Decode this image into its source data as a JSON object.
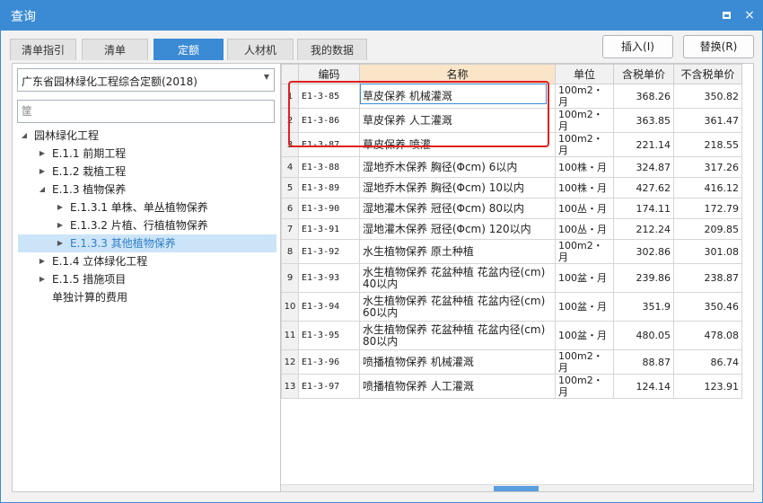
{
  "window": {
    "title": "查询",
    "maximize_icon": "maximize-icon",
    "close_icon": "close-icon",
    "close_glyph": "×"
  },
  "tabs": [
    {
      "label": "清单指引",
      "active": false
    },
    {
      "label": "清单",
      "active": false
    },
    {
      "label": "定额",
      "active": true
    },
    {
      "label": "人材机",
      "active": false
    },
    {
      "label": "我的数据",
      "active": false
    }
  ],
  "actions": {
    "insert_label": "插入(I)",
    "replace_label": "替换(R)"
  },
  "left": {
    "dropdown_value": "广东省园林绿化工程综合定额(2018)",
    "search_placeholder": "筐",
    "tree": [
      {
        "label": "园林绿化工程",
        "level": 0,
        "expanded": true
      },
      {
        "label": "E.1.1 前期工程",
        "level": 1,
        "expanded": false
      },
      {
        "label": "E.1.2 栽植工程",
        "level": 1,
        "expanded": false
      },
      {
        "label": "E.1.3 植物保养",
        "level": 1,
        "expanded": true
      },
      {
        "label": "E.1.3.1 单株、单丛植物保养",
        "level": 2,
        "expanded": false
      },
      {
        "label": "E.1.3.2 片植、行植植物保养",
        "level": 2,
        "expanded": false
      },
      {
        "label": "E.1.3.3 其他植物保养",
        "level": 2,
        "expanded": false,
        "selected": true
      },
      {
        "label": "E.1.4 立体绿化工程",
        "level": 1,
        "expanded": false
      },
      {
        "label": "E.1.5 措施项目",
        "level": 1,
        "expanded": false
      },
      {
        "label": "单独计算的费用",
        "level": 1,
        "leaf": true
      }
    ]
  },
  "grid": {
    "columns": [
      "编码",
      "名称",
      "单位",
      "含税单价",
      "不含税单价"
    ],
    "rows": [
      {
        "no": "1",
        "code": "E1-3-85",
        "name": "草皮保养 机械灌溉",
        "unit": "100m2・月",
        "price_tax": "368.26",
        "price_notax": "350.82"
      },
      {
        "no": "2",
        "code": "E1-3-86",
        "name": "草皮保养 人工灌溉",
        "unit": "100m2・月",
        "price_tax": "363.85",
        "price_notax": "361.47"
      },
      {
        "no": "3",
        "code": "E1-3-87",
        "name": "草皮保养 喷灌",
        "unit": "100m2・月",
        "price_tax": "221.14",
        "price_notax": "218.55"
      },
      {
        "no": "4",
        "code": "E1-3-88",
        "name": "湿地乔木保养 胸径(Φcm) 6以内",
        "unit": "100株・月",
        "price_tax": "324.87",
        "price_notax": "317.26"
      },
      {
        "no": "5",
        "code": "E1-3-89",
        "name": "湿地乔木保养 胸径(Φcm) 10以内",
        "unit": "100株・月",
        "price_tax": "427.62",
        "price_notax": "416.12"
      },
      {
        "no": "6",
        "code": "E1-3-90",
        "name": "湿地灌木保养 冠径(Φcm) 80以内",
        "unit": "100丛・月",
        "price_tax": "174.11",
        "price_notax": "172.79"
      },
      {
        "no": "7",
        "code": "E1-3-91",
        "name": "湿地灌木保养 冠径(Φcm) 120以内",
        "unit": "100丛・月",
        "price_tax": "212.24",
        "price_notax": "209.85"
      },
      {
        "no": "8",
        "code": "E1-3-92",
        "name": "水生植物保养 原土种植",
        "unit": "100m2・月",
        "price_tax": "302.86",
        "price_notax": "301.08"
      },
      {
        "no": "9",
        "code": "E1-3-93",
        "name": "水生植物保养 花盆种植 花盆内径(cm) 40以内",
        "unit": "100盆・月",
        "price_tax": "239.86",
        "price_notax": "238.87"
      },
      {
        "no": "10",
        "code": "E1-3-94",
        "name": "水生植物保养 花盆种植 花盆内径(cm) 60以内",
        "unit": "100盆・月",
        "price_tax": "351.9",
        "price_notax": "350.46"
      },
      {
        "no": "11",
        "code": "E1-3-95",
        "name": "水生植物保养 花盆种植 花盆内径(cm) 80以内",
        "unit": "100盆・月",
        "price_tax": "480.05",
        "price_notax": "478.08"
      },
      {
        "no": "12",
        "code": "E1-3-96",
        "name": "喷播植物保养 机械灌溉",
        "unit": "100m2・月",
        "price_tax": "88.87",
        "price_notax": "86.74"
      },
      {
        "no": "13",
        "code": "E1-3-97",
        "name": "喷播植物保养 人工灌溉",
        "unit": "100m2・月",
        "price_tax": "124.14",
        "price_notax": "123.91"
      }
    ],
    "highlight_color": "#e02020"
  },
  "colors": {
    "accent": "#3b8bd4",
    "selected_bg": "#cce4f7",
    "name_header_bg": "#fbe5c9"
  }
}
